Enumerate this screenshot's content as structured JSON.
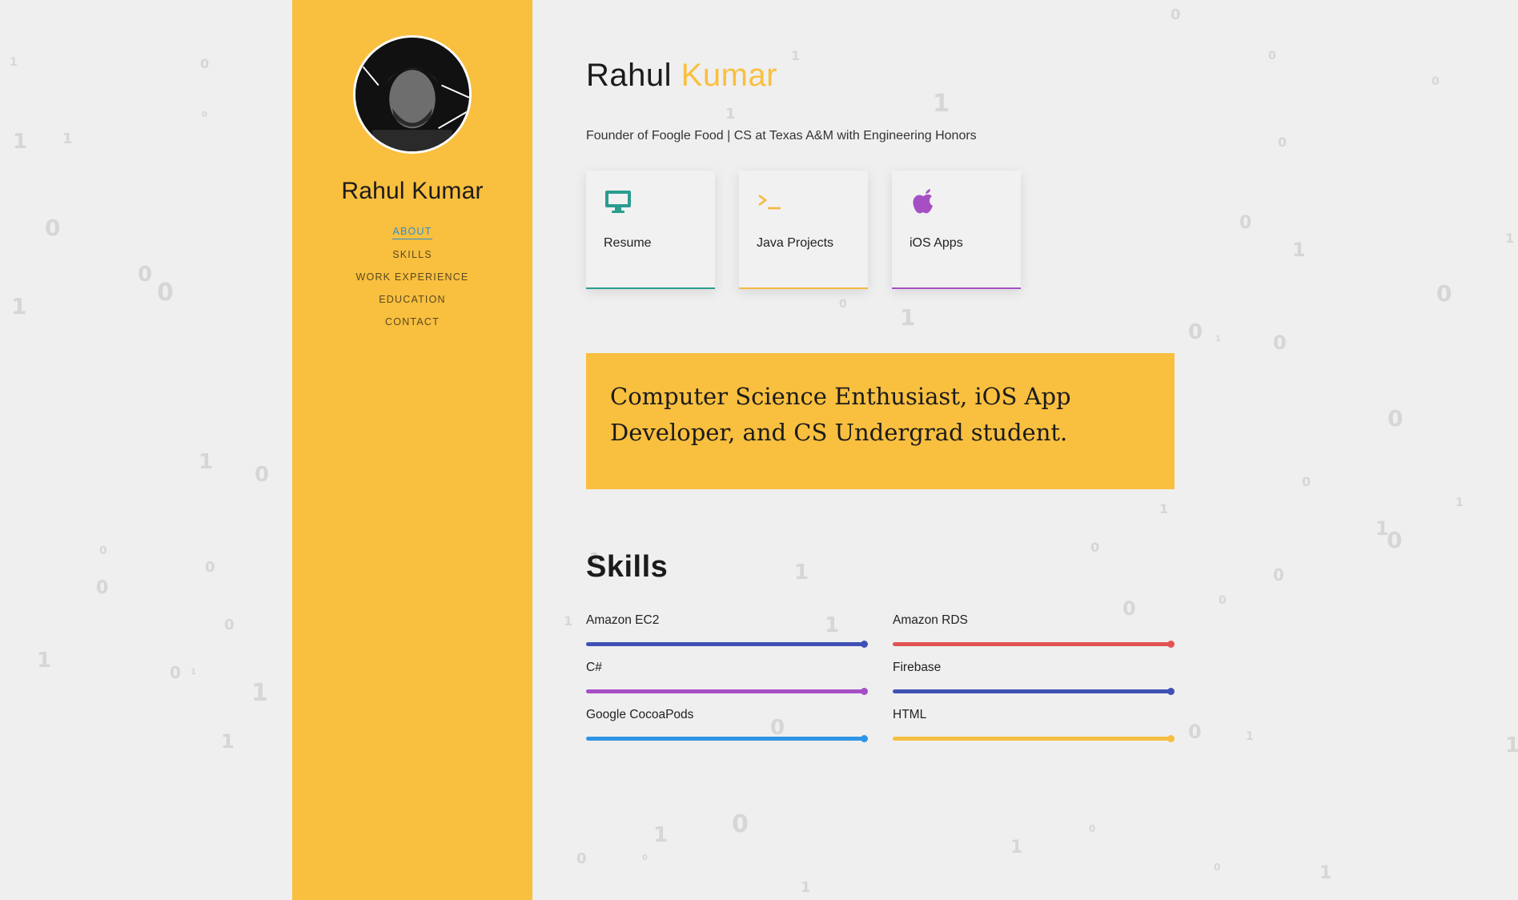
{
  "sidebar": {
    "name": "Rahul Kumar",
    "nav": [
      {
        "label": "ABOUT",
        "active": true
      },
      {
        "label": "SKILLS",
        "active": false
      },
      {
        "label": "WORK EXPERIENCE",
        "active": false
      },
      {
        "label": "EDUCATION",
        "active": false
      },
      {
        "label": "CONTACT",
        "active": false
      }
    ]
  },
  "header": {
    "first_name": "Rahul",
    "last_name": "Kumar",
    "subtitle": "Founder of Foogle Food | CS at Texas A&M with Engineering Honors"
  },
  "cards": [
    {
      "label": "Resume",
      "icon": "desktop-icon",
      "color": "#2a9d8f"
    },
    {
      "label": "Java Projects",
      "icon": "terminal-icon",
      "color": "#f4b942"
    },
    {
      "label": "iOS Apps",
      "icon": "apple-icon",
      "color": "#a64fc4"
    }
  ],
  "quote": "Computer Science Enthusiast, iOS App Developer, and CS Undergrad student.",
  "skills": {
    "title": "Skills",
    "items": [
      {
        "name": "Amazon EC2",
        "level": 1.0,
        "color": "#3f51b5"
      },
      {
        "name": "Amazon RDS",
        "level": 1.0,
        "color": "#e25353"
      },
      {
        "name": "C#",
        "level": 1.0,
        "color": "#a64fc4"
      },
      {
        "name": "Firebase",
        "level": 1.0,
        "color": "#3f51b5"
      },
      {
        "name": "Google CocoaPods",
        "level": 1.0,
        "color": "#2e95e6"
      },
      {
        "name": "HTML",
        "level": 1.0,
        "color": "#f4bf40"
      }
    ]
  },
  "colors": {
    "accent": "#f9bf3f",
    "active_link": "#2a8fd6",
    "background": "#efefef"
  }
}
